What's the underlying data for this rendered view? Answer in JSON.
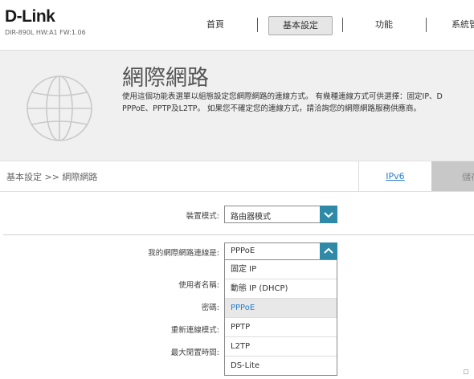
{
  "header": {
    "logo": "D-Link",
    "model": "DIR-890L   HW:A1   FW:1.06"
  },
  "nav": {
    "items": [
      {
        "label": "首頁",
        "active": false
      },
      {
        "label": "基本設定",
        "active": true
      },
      {
        "label": "功能",
        "active": false
      },
      {
        "label": "系統管",
        "active": false
      }
    ]
  },
  "hero": {
    "title": "網際網路",
    "description_line1": "使用這個功能表選單以組態設定您網際網路的連線方式。 有幾種連線方式可供選擇：固定IP、D",
    "description_line2": "PPPoE、PPTP及L2TP。 如果您不確定您的連線方式，請洽詢您的網際網路服務供應商。"
  },
  "subnav": {
    "breadcrumb": "基本設定 >> 網際網路",
    "tab_ipv6": "IPv6",
    "tab_save": "儲存"
  },
  "form": {
    "device_mode_label": "裝置模式:",
    "device_mode_value": "路由器模式",
    "connection_label": "我的網際網路連線是:",
    "connection_value": "PPPoE",
    "username_label": "使用者名稱:",
    "password_label": "密碼:",
    "reconnect_label": "重新連線模式:",
    "idle_time_label": "最大閒置時間:"
  },
  "dropdown": {
    "selected": "PPPoE",
    "options": [
      "固定 IP",
      "動態 IP (DHCP)",
      "PPPoE",
      "PPTP",
      "L2TP",
      "DS-Lite"
    ]
  },
  "colors": {
    "accent": "#2e8aa6",
    "link": "#2b80c8",
    "hero_bg": "#f0f0f0"
  }
}
